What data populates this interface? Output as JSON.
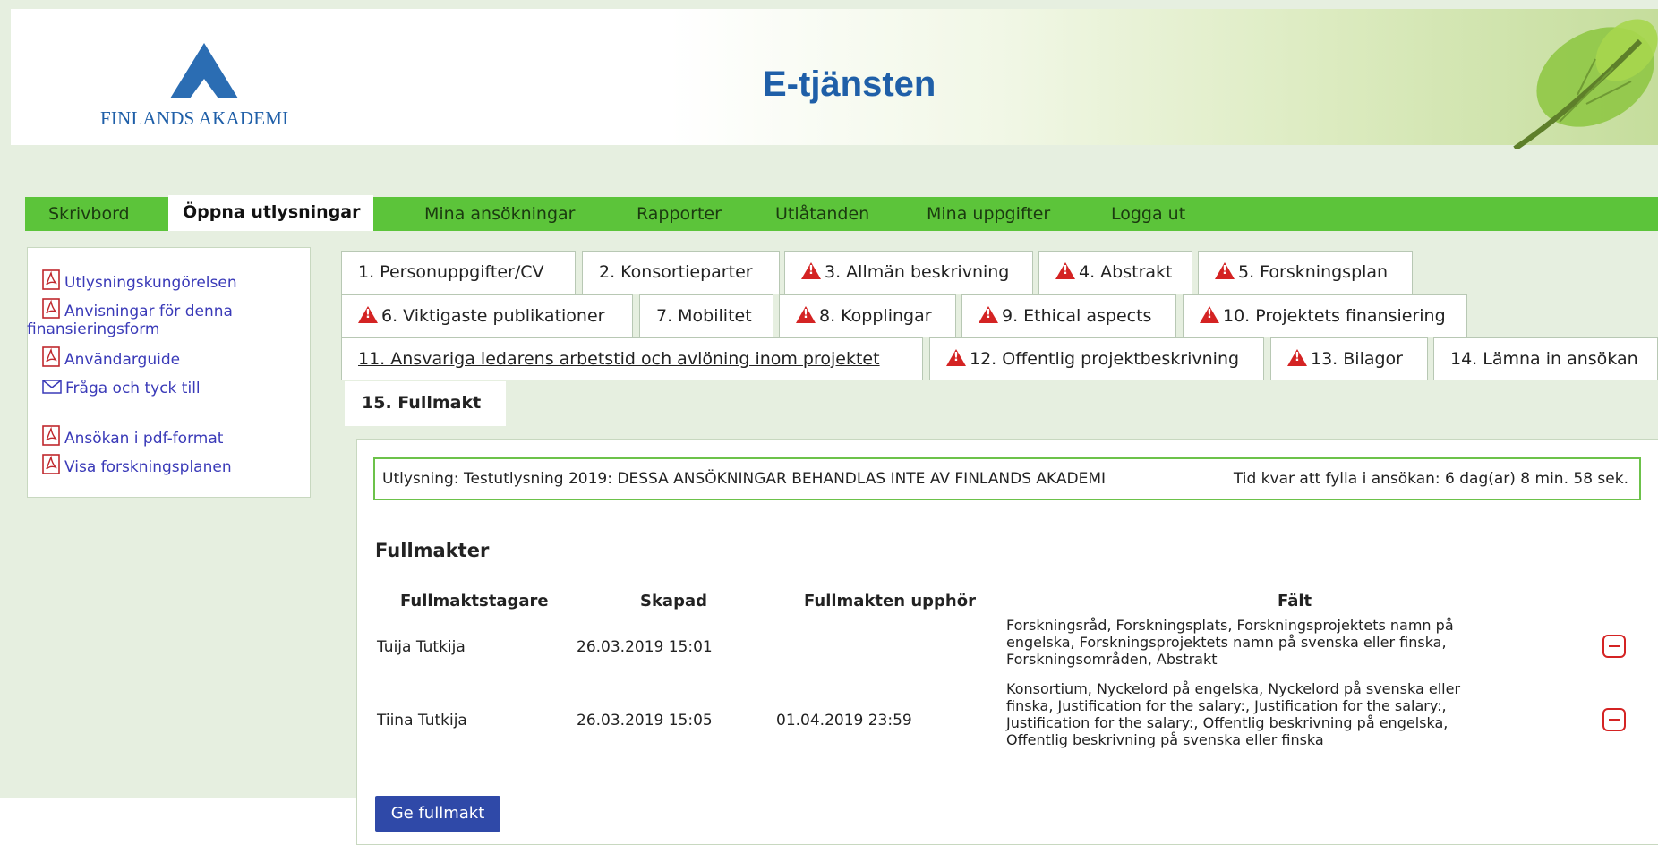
{
  "header": {
    "logo_text": "FINLANDS AKADEMI",
    "app_title": "E-tjänsten"
  },
  "main_nav": {
    "items": [
      {
        "label": "Skrivbord"
      },
      {
        "label": "Öppna utlysningar",
        "active": true
      },
      {
        "label": "Mina ansökningar"
      },
      {
        "label": "Rapporter"
      },
      {
        "label": "Utlåtanden"
      },
      {
        "label": "Mina uppgifter"
      },
      {
        "label": "Logga ut"
      }
    ]
  },
  "sidebar": {
    "links": [
      {
        "label": "Utlysningskungörelsen",
        "icon": "pdf-icon"
      },
      {
        "label_line1": "Anvisningar för denna",
        "label_line2": "finansieringsform",
        "icon": "pdf-icon"
      },
      {
        "label": "Användarguide",
        "icon": "pdf-icon"
      },
      {
        "label": "Fråga och tyck till",
        "icon": "mail-icon"
      },
      {
        "label": "Ansökan i pdf-format",
        "icon": "pdf-icon"
      },
      {
        "label": "Visa forskningsplanen",
        "icon": "pdf-icon"
      }
    ]
  },
  "tabs": [
    {
      "label": "1. Personuppgifter/CV",
      "warning": false
    },
    {
      "label": "2. Konsortieparter",
      "warning": false
    },
    {
      "label": "3. Allmän beskrivning",
      "warning": true
    },
    {
      "label": "4. Abstrakt",
      "warning": true
    },
    {
      "label": "5. Forskningsplan",
      "warning": true
    },
    {
      "label": "6. Viktigaste publikationer",
      "warning": true
    },
    {
      "label": "7. Mobilitet",
      "warning": false
    },
    {
      "label": "8. Kopplingar",
      "warning": true
    },
    {
      "label": "9. Ethical aspects",
      "warning": true
    },
    {
      "label": "10. Projektets finansiering",
      "warning": true
    },
    {
      "label": "11. Ansvariga ledarens arbetstid och avlöning inom projektet",
      "warning": false
    },
    {
      "label": "12. Offentlig projektbeskrivning",
      "warning": true
    },
    {
      "label": "13. Bilagor",
      "warning": true
    },
    {
      "label": "14. Lämna in ansökan",
      "warning": false
    },
    {
      "label": "15. Fullmakt",
      "warning": false,
      "active": true
    }
  ],
  "info_bar": {
    "call": "Utlysning: Testutlysning 2019: DESSA ANSÖKNINGAR BEHANDLAS INTE AV FINLANDS AKADEMI",
    "time_left": "Tid kvar att fylla i ansökan: 6 dag(ar) 8 min. 58 sek."
  },
  "fullmakter": {
    "title": "Fullmakter",
    "columns": [
      "Fullmaktstagare",
      "Skapad",
      "Fullmakten upphör",
      "Fält"
    ],
    "rows": [
      {
        "holder": "Tuija Tutkija",
        "created": "26.03.2019 15:01",
        "expires": "",
        "fields": "Forskningsråd, Forskningsplats, Forskningsprojektets namn på engelska, Forskningsprojektets namn på svenska eller finska, Forskningsområden, Abstrakt"
      },
      {
        "holder": "Tiina Tutkija",
        "created": "26.03.2019 15:05",
        "expires": "01.04.2019 23:59",
        "fields": "Konsortium, Nyckelord på engelska, Nyckelord på svenska eller finska, Justification for the salary:, Justification for the salary:, Justification for the salary:, Offentlig beskrivning på engelska, Offentlig beskrivning på svenska eller finska"
      }
    ],
    "give_button": "Ge fullmakt"
  },
  "colors": {
    "nav_green": "#5cc43a",
    "brand_blue": "#1f5fa8",
    "warning_red": "#d42323",
    "button_blue": "#2f49a8"
  }
}
